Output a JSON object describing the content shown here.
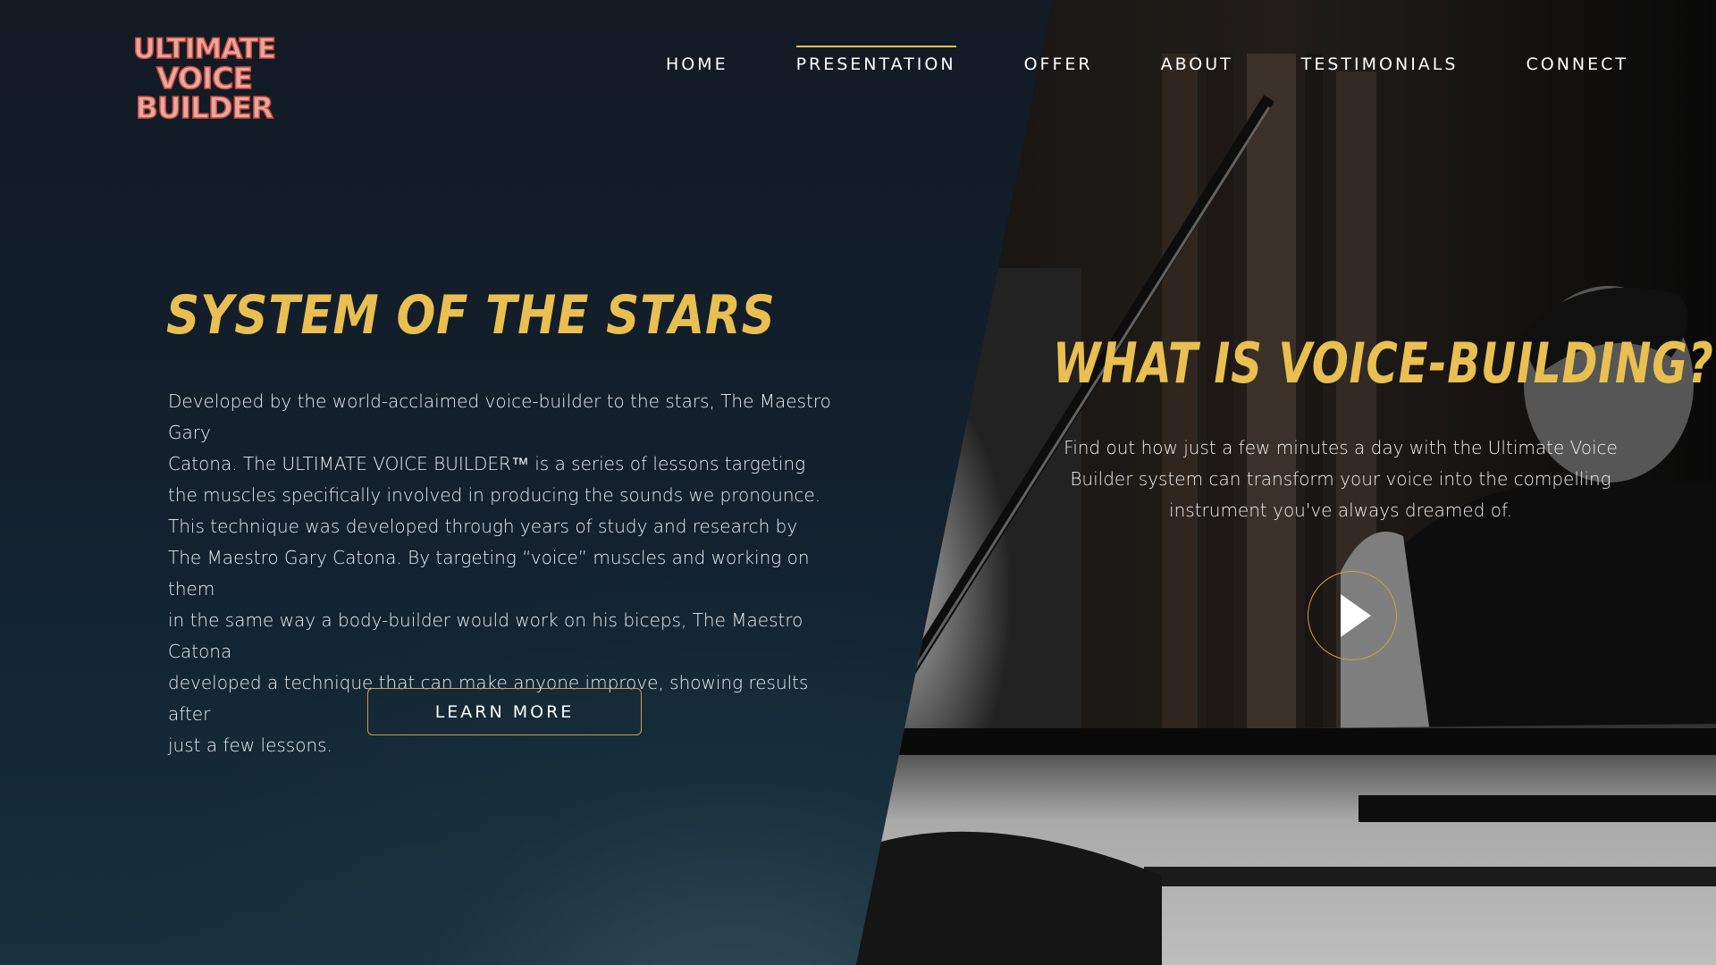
{
  "logo": {
    "line1": "ULTIMATE",
    "line2": "VOICE BUILDER"
  },
  "nav": {
    "items": [
      {
        "label": "HOME"
      },
      {
        "label": "PRESENTATION"
      },
      {
        "label": "OFFER"
      },
      {
        "label": "ABOUT"
      },
      {
        "label": "TESTIMONIALS"
      },
      {
        "label": "CONNECT"
      }
    ],
    "active": "PRESENTATION"
  },
  "left": {
    "title": "SYSTEM OF THE STARS",
    "body_lines": [
      "Developed by the world-acclaimed voice-builder to the stars, The Maestro Gary",
      "Catona. The ULTIMATE VOICE BUILDER™ is a series of lessons targeting",
      "the muscles specifically involved in producing the sounds we pronounce.",
      "This technique was developed through years of study and research by",
      "The Maestro Gary Catona. By targeting “voice” muscles and working on them",
      "in the same way a body-builder would work on his biceps, The Maestro Catona",
      "developed a technique that can make anyone improve, showing results after",
      "just a few lessons."
    ],
    "button_label": "LEARN MORE"
  },
  "right": {
    "title": "WHAT IS VOICE-BUILDING?",
    "body_lines": [
      "Find out how just a few minutes a day with the Ultimate Voice",
      "Builder system can transform your voice into the compelling",
      "instrument you've always dreamed of."
    ]
  },
  "colors": {
    "accent": "#e9bf51",
    "background": "#0f1a24",
    "logo_red": "#c84a3a"
  },
  "icons": {
    "play": "play-icon"
  }
}
